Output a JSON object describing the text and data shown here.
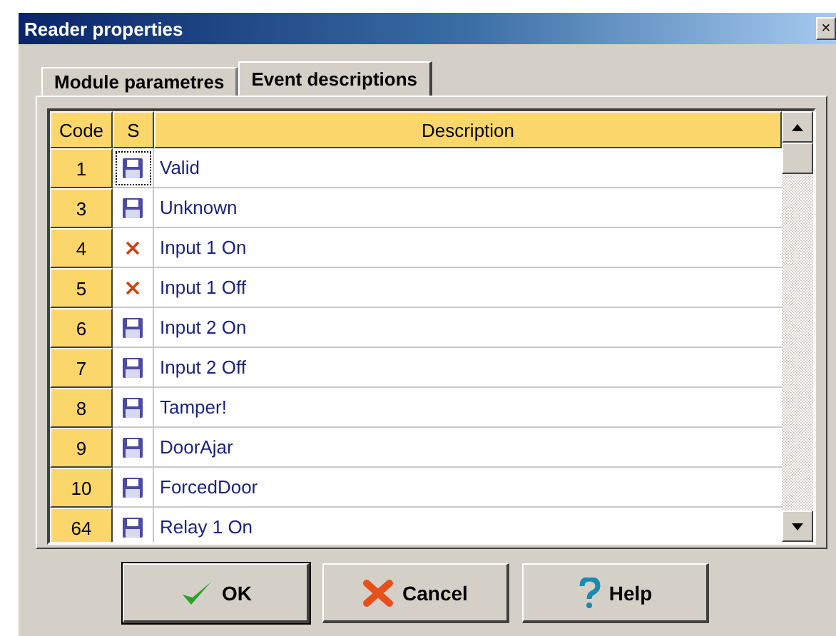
{
  "window": {
    "title": "Reader properties",
    "close": "×"
  },
  "tabs": [
    {
      "label": "Module parametres",
      "selected": false
    },
    {
      "label": "Event descriptions",
      "selected": true
    }
  ],
  "table": {
    "columns": [
      "Code",
      "S",
      "Description"
    ],
    "rows": [
      {
        "code": "1",
        "kind": "save",
        "description": "Valid",
        "selected": true
      },
      {
        "code": "3",
        "kind": "save",
        "description": "Unknown",
        "selected": false
      },
      {
        "code": "4",
        "kind": "cross",
        "description": "Input 1 On",
        "selected": false
      },
      {
        "code": "5",
        "kind": "cross",
        "description": "Input 1 Off",
        "selected": false
      },
      {
        "code": "6",
        "kind": "save",
        "description": "Input 2 On",
        "selected": false
      },
      {
        "code": "7",
        "kind": "save",
        "description": "Input 2 Off",
        "selected": false
      },
      {
        "code": "8",
        "kind": "save",
        "description": "Tamper!",
        "selected": false
      },
      {
        "code": "9",
        "kind": "save",
        "description": "DoorAjar",
        "selected": false
      },
      {
        "code": "10",
        "kind": "save",
        "description": "ForcedDoor",
        "selected": false
      },
      {
        "code": "64",
        "kind": "save",
        "description": "Relay 1 On",
        "selected": false
      }
    ]
  },
  "buttons": [
    {
      "label": "OK",
      "kind": "ok",
      "default": true
    },
    {
      "label": "Cancel",
      "kind": "cancel",
      "default": false
    },
    {
      "label": "Help",
      "kind": "help",
      "default": false
    }
  ]
}
